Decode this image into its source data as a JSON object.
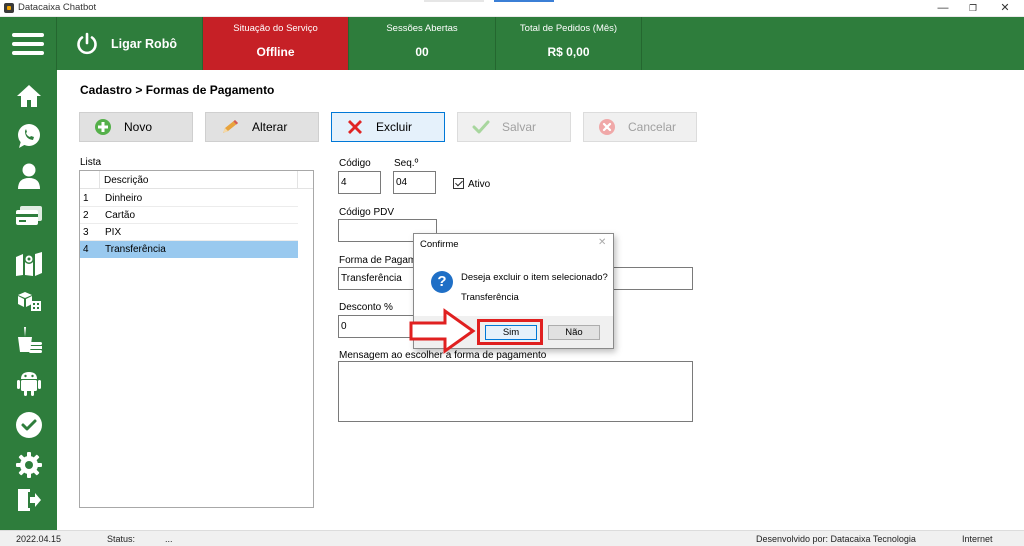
{
  "window": {
    "title": "Datacaixa Chatbot",
    "minimize_glyph": "—",
    "restore_glyph": "❐",
    "close_glyph": "✕"
  },
  "header": {
    "robot_label": "Ligar Robô",
    "stats": [
      {
        "title": "Situação do Serviço",
        "value": "Offline",
        "color": "#c62026"
      },
      {
        "title": "Sessões Abertas",
        "value": "00"
      },
      {
        "title": "Total de Pedidos (Mês)",
        "value": "R$ 0,00"
      }
    ]
  },
  "colors": {
    "brand_green": "#2e7d3c",
    "offline_red": "#c62026",
    "selection_blue": "#99c9ef",
    "highlight_red": "#e02020"
  },
  "sidebar": {
    "items": [
      {
        "icon": "home-icon"
      },
      {
        "icon": "whatsapp-icon"
      },
      {
        "icon": "user-icon"
      },
      {
        "icon": "credit-card-icon"
      },
      {
        "icon": "map-icon"
      },
      {
        "icon": "products-icon"
      },
      {
        "icon": "food-delivery-icon"
      },
      {
        "icon": "android-icon"
      },
      {
        "icon": "check-icon"
      },
      {
        "icon": "settings-icon"
      },
      {
        "icon": "logout-icon"
      }
    ]
  },
  "breadcrumb": "Cadastro > Formas de Pagamento",
  "toolbar": {
    "new_label": "Novo",
    "edit_label": "Alterar",
    "delete_label": "Excluir",
    "save_label": "Salvar",
    "cancel_label": "Cancelar"
  },
  "list": {
    "label": "Lista",
    "header": "Descrição",
    "rows": [
      {
        "id": "1",
        "desc": "Dinheiro"
      },
      {
        "id": "2",
        "desc": "Cartão"
      },
      {
        "id": "3",
        "desc": "PIX"
      },
      {
        "id": "4",
        "desc": "Transferência",
        "selected": true
      }
    ]
  },
  "form": {
    "codigo_label": "Código",
    "codigo_value": "4",
    "seq_label": "Seq.º",
    "seq_value": "04",
    "ativo_label": "Ativo",
    "ativo_checked": true,
    "codigo_pdv_label": "Código PDV",
    "codigo_pdv_value": "",
    "forma_label": "Forma de Pagamento",
    "forma_value": "Transferência",
    "desconto_label": "Desconto %",
    "desconto_value": "0",
    "mensagem_label": "Mensagem ao escolher a forma de pagamento",
    "mensagem_value": ""
  },
  "dialog": {
    "title": "Confirme",
    "close_glyph": "✕",
    "message": "Deseja excluir o item selecionado?",
    "item": "Transferência",
    "yes_label": "Sim",
    "no_label": "Não"
  },
  "statusbar": {
    "version": "2022.04.15",
    "status_label": "Status:",
    "status_value": "...",
    "developer": "Desenvolvido por: Datacaixa Tecnologia",
    "connection": "Internet"
  }
}
